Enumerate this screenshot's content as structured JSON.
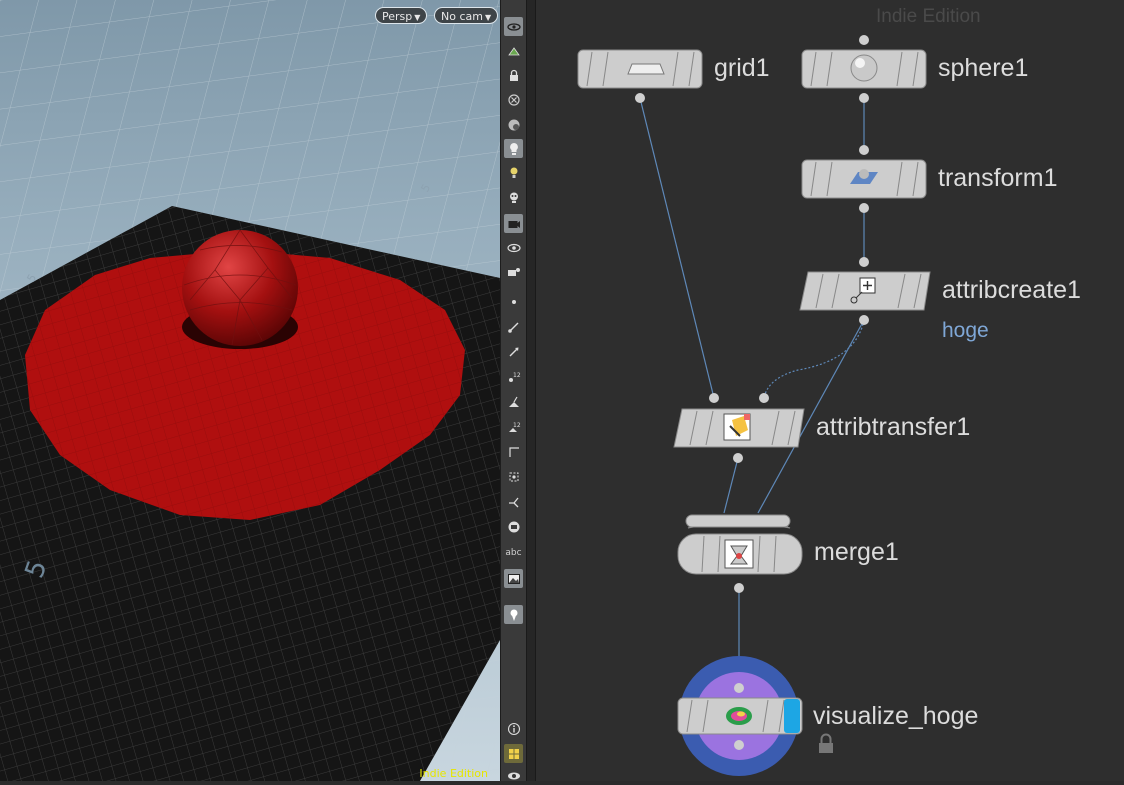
{
  "viewport": {
    "camera_view": "Persp",
    "camera": "No cam",
    "watermark": "Indie Edition",
    "grid_marks": [
      "5",
      "5",
      "5"
    ],
    "colors": {
      "ground": "#9fb2bf",
      "grid_plane": "#1e1e1e",
      "attribute_red": "#b50f0f"
    }
  },
  "toolbar": {
    "items": [
      {
        "icon": "display-options-icon",
        "active": true
      },
      {
        "icon": "shading-icon",
        "active": false
      },
      {
        "icon": "lock-camera-icon",
        "active": false
      },
      {
        "icon": "ghost-icon",
        "active": false
      },
      {
        "icon": "sphere-display-icon",
        "active": false
      },
      {
        "icon": "lighting-icon",
        "active": true
      },
      {
        "icon": "light-icon",
        "active": false
      },
      {
        "icon": "skull-light-icon",
        "active": false
      },
      {
        "icon": "camera-icon",
        "active": true
      },
      {
        "icon": "eye-icon",
        "active": false
      },
      {
        "icon": "camera-view-icon",
        "active": false
      },
      {
        "icon": "point-icon",
        "active": false
      },
      {
        "icon": "normal-icon",
        "active": false
      },
      {
        "icon": "vector-icon",
        "active": false
      },
      {
        "icon": "point-numbers-icon",
        "active": false
      },
      {
        "icon": "primitive-normal-icon",
        "active": false
      },
      {
        "icon": "primitive-numbers-icon",
        "active": false
      },
      {
        "icon": "edge-icon",
        "active": false
      },
      {
        "icon": "snap-icon",
        "active": false
      },
      {
        "icon": "branch-icon",
        "active": false
      },
      {
        "icon": "circle-stop-icon",
        "active": false
      },
      {
        "icon": "text-abc-icon",
        "active": false,
        "label": "abc"
      },
      {
        "icon": "background-image-icon",
        "active": true
      },
      {
        "icon": "pin-icon",
        "active": true
      },
      {
        "icon": "info-icon",
        "active": false
      },
      {
        "icon": "grid-layout-icon",
        "active": true
      },
      {
        "icon": "visibility-icon",
        "active": false
      }
    ]
  },
  "network": {
    "watermark": "Indie Edition",
    "nodes": {
      "grid1": {
        "name": "grid1",
        "icon": "grid-plane-icon"
      },
      "sphere1": {
        "name": "sphere1",
        "icon": "sphere-icon"
      },
      "transform1": {
        "name": "transform1",
        "icon": "transform-icon"
      },
      "attribcreate1": {
        "name": "attribcreate1",
        "icon": "attribcreate-icon",
        "attribute": "hoge"
      },
      "attribtransfer1": {
        "name": "attribtransfer1",
        "icon": "attribtransfer-icon"
      },
      "merge1": {
        "name": "merge1",
        "icon": "merge-icon"
      },
      "visualize_hoge": {
        "name": "visualize_hoge",
        "icon": "visualize-icon",
        "display_flag": true,
        "locked": true
      }
    },
    "colors": {
      "node_body": "#cdcdcd",
      "wire": "#5e88b8",
      "display_flag": "#1da6e4",
      "ring_outer": "#3b5cb0",
      "ring_inner": "#9b73e0"
    }
  }
}
